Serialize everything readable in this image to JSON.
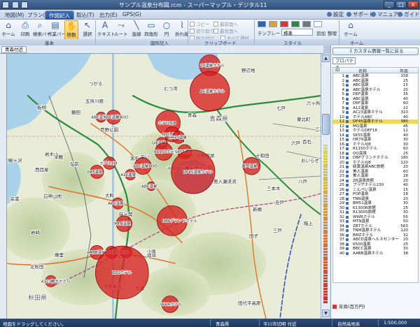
{
  "window": {
    "title": "サンプル温泉分布図.rcm - スーパーマップル・デジタル11",
    "minimize": "_",
    "maximize": "□",
    "close": "×"
  },
  "menu": {
    "tabs": [
      "地図(M)",
      "プラン(P)",
      "作図記入",
      "取込(T)",
      "出力(E)",
      "GPS(G)"
    ],
    "right": [
      "設定",
      "サポート",
      "マニュアル",
      "ガイドマップ"
    ]
  },
  "ribbon": {
    "buttons": [
      "ホーム",
      "印刷",
      "検索バー",
      "作業バー",
      "移動",
      "選択",
      "テキスト",
      "ルート",
      "直線",
      "四角形",
      "円",
      "折れ線",
      "ホーム\n登録"
    ],
    "clipboard": [
      "コピー",
      "切り取り",
      "貼り付け",
      "リストから削除",
      "最前面へ",
      "最背面へ",
      "すべて選択"
    ],
    "style": {
      "template_label": "テンプレート",
      "template_value": "標準",
      "add": "追加",
      "arrange": "整理"
    },
    "groups": [
      "基本",
      "図形記入",
      "クリップボード",
      "スタイル",
      "ホーム"
    ]
  },
  "map_tab": "青森付近",
  "map": {
    "places": [
      "野辺地",
      "青森",
      "五所川原",
      "鶴田",
      "板柳",
      "弘前",
      "黒石",
      "平川",
      "大鰐",
      "碇ヶ関",
      "鰺ヶ沢",
      "深浦",
      "西目屋",
      "岩崎",
      "白神山地",
      "十和田湖",
      "十和田",
      "七戸",
      "六戸",
      "三沢",
      "八戸",
      "五戸",
      "三戸",
      "新郷",
      "田子",
      "鹿角",
      "小坂",
      "大館",
      "北秋田",
      "能代",
      "藤里",
      "三本木",
      "つがる",
      "むつ湾",
      "青森県",
      "秋田県",
      "十和田八幡平国立公園",
      "奥入瀬渓流",
      "芦野公園",
      "弘前公園",
      "津軽",
      "岩木山",
      "八甲田",
      "東北町",
      "六ヶ所",
      "おいらせ",
      "百石",
      "階上",
      "田代平高原",
      "大湯",
      "大館能代"
    ],
    "bubbles": [
      {
        "label": "ZX温泉ホテル",
        "v": 88,
        "lon": 140.92,
        "lat": 40.96
      },
      {
        "label": "AC温泉ホテル",
        "v": 310,
        "lon": 140.92,
        "lat": 40.87
      },
      {
        "label": "ABC温泉ホテル",
        "v": 20,
        "lon": 140.4,
        "lat": 40.78
      },
      {
        "label": "ABC温泉BOO",
        "v": 40,
        "lon": 140.46,
        "lat": 40.78
      },
      {
        "label": "ホテルXJ8",
        "v": 120,
        "lon": 140.72,
        "lat": 40.76
      },
      {
        "label": "MO温泉",
        "v": 45,
        "lon": 140.74,
        "lat": 40.72
      },
      {
        "label": "HR79温泉",
        "v": 30,
        "lon": 140.77,
        "lat": 40.71
      },
      {
        "label": "QQ温泉",
        "v": 25,
        "lon": 140.69,
        "lat": 40.69
      },
      {
        "label": "R1150ホテル",
        "v": 60,
        "lon": 140.7,
        "lat": 40.66
      },
      {
        "label": "SK55温泉",
        "v": 40,
        "lon": 140.8,
        "lat": 40.66
      },
      {
        "label": "ホテルXJ8",
        "v": 30,
        "lon": 140.44,
        "lat": 40.62
      },
      {
        "label": "ABC温泉BOO",
        "v": 55,
        "lon": 140.6,
        "lat": 40.61
      },
      {
        "label": "DF45温泉ホテル",
        "v": 380,
        "lon": 140.84,
        "lat": 40.59
      },
      {
        "label": "美人温泉",
        "v": 60,
        "lon": 141.12,
        "lat": 40.61
      },
      {
        "label": "DEF温泉",
        "v": 35,
        "lon": 140.38,
        "lat": 40.59
      },
      {
        "label": "A12温泉",
        "v": 22,
        "lon": 140.54,
        "lat": 40.58
      },
      {
        "label": "ABC温泉",
        "v": 15,
        "lon": 140.64,
        "lat": 40.54
      },
      {
        "label": "ABC温泉",
        "v": 25,
        "lon": 140.48,
        "lat": 40.48
      },
      {
        "label": "MTN温泉",
        "v": 50,
        "lon": 140.51,
        "lat": 40.41
      },
      {
        "label": "DBPグランドホテル",
        "v": 180,
        "lon": 140.74,
        "lat": 40.42
      },
      {
        "label": "AABB温泉",
        "v": 38,
        "lon": 140.38,
        "lat": 40.31
      },
      {
        "label": "NW温泉",
        "v": 30,
        "lon": 140.45,
        "lat": 40.31
      },
      {
        "label": "T305B",
        "v": 25,
        "lon": 140.52,
        "lat": 40.31
      },
      {
        "label": "ZD1ホテル",
        "v": 560,
        "lon": 140.5,
        "lat": 40.24
      },
      {
        "label": "A123観光ホテル",
        "v": 25,
        "lon": 140.16,
        "lat": 40.21
      },
      {
        "label": "WWRホテル",
        "v": 55,
        "lon": 140.73,
        "lat": 40.13
      }
    ]
  },
  "panel": {
    "back_button": "《 カスタム情報一覧に戻る",
    "property_button": "プロパティ",
    "columns": {
      "id": "ID",
      "name": "名称",
      "value": "年商"
    },
    "rows": [
      {
        "id": "1",
        "name": "ABC温泉",
        "value": "158"
      },
      {
        "id": "2",
        "name": "ABC温泉",
        "value": "25"
      },
      {
        "id": "3",
        "name": "ABC温泉",
        "value": "15"
      },
      {
        "id": "4",
        "name": "ABC温泉ホテル",
        "value": "20"
      },
      {
        "id": "5",
        "name": "DEF温泉",
        "value": "35"
      },
      {
        "id": "6",
        "name": "ABC温泉",
        "value": "40"
      },
      {
        "id": "7",
        "name": "DEF温泉",
        "value": "60"
      },
      {
        "id": "8",
        "name": "A12温泉",
        "value": "22"
      },
      {
        "id": "9",
        "name": "AC23温泉ホテル",
        "value": "310"
      },
      {
        "id": "10",
        "name": "ホテルABC",
        "value": "40"
      },
      {
        "id": "11",
        "name": "DF45温泉ホテル",
        "value": "380"
      },
      {
        "id": "12",
        "name": "MO温泉",
        "value": "45"
      },
      {
        "id": "13",
        "name": "ホテルDEF18",
        "value": "12"
      },
      {
        "id": "14",
        "name": "SK55温泉",
        "value": "40"
      },
      {
        "id": "15",
        "name": "HR79温泉",
        "value": "30"
      },
      {
        "id": "16",
        "name": "ホテルXJ8",
        "value": "30"
      },
      {
        "id": "17",
        "name": "R1150ホテル",
        "value": "60"
      },
      {
        "id": "18",
        "name": "QQ温泉",
        "value": "25"
      },
      {
        "id": "19",
        "name": "DBPグランドホテル",
        "value": "180"
      },
      {
        "id": "20",
        "name": "ホテルXJ8",
        "value": "120"
      },
      {
        "id": "21",
        "name": "硫黄温泉ABC旅館",
        "value": "20"
      },
      {
        "id": "22",
        "name": "美人温泉",
        "value": "60"
      },
      {
        "id": "23",
        "name": "美人温泉",
        "value": "28"
      },
      {
        "id": "24",
        "name": "ZR温泉旅館",
        "value": "20"
      },
      {
        "id": "25",
        "name": "プラザホテル230",
        "value": "40"
      },
      {
        "id": "26",
        "name": "こんぺい温泉",
        "value": "15"
      },
      {
        "id": "27",
        "name": "POP温泉",
        "value": "18"
      },
      {
        "id": "28",
        "name": "TNN温泉",
        "value": "20"
      },
      {
        "id": "29",
        "name": "BM51温泉",
        "value": "30"
      },
      {
        "id": "30",
        "name": "K1300R旅館",
        "value": "25"
      },
      {
        "id": "31",
        "name": "R1300S旅館",
        "value": "30"
      },
      {
        "id": "32",
        "name": "WWRホテル",
        "value": "55"
      },
      {
        "id": "33",
        "name": "MTN温泉",
        "value": "50"
      },
      {
        "id": "34",
        "name": "ZBTホテル",
        "value": "563"
      },
      {
        "id": "35",
        "name": "TNM温泉ホテル",
        "value": "120"
      },
      {
        "id": "36",
        "name": "BMZホテル",
        "value": "32"
      },
      {
        "id": "37",
        "name": "ABCD温泉ヘルスセンター",
        "value": "20"
      },
      {
        "id": "38",
        "name": "6500温泉",
        "value": "25"
      },
      {
        "id": "39",
        "name": "BBCC温泉",
        "value": "30"
      },
      {
        "id": "40",
        "name": "AABB温泉ホテル",
        "value": "38"
      }
    ],
    "legend": "年商(百万円)"
  },
  "status": {
    "hint": "地図をドラッグしてください。",
    "pref": "青森県",
    "city": "平川市切明 付近",
    "mode": "自然高地系",
    "scale": "1:500,000"
  },
  "colors": {
    "bubble": "#d82020",
    "bubble_outline": "#8a0c0c",
    "ribbon_active": "#f6c84e",
    "selection": "#f2d84a"
  }
}
